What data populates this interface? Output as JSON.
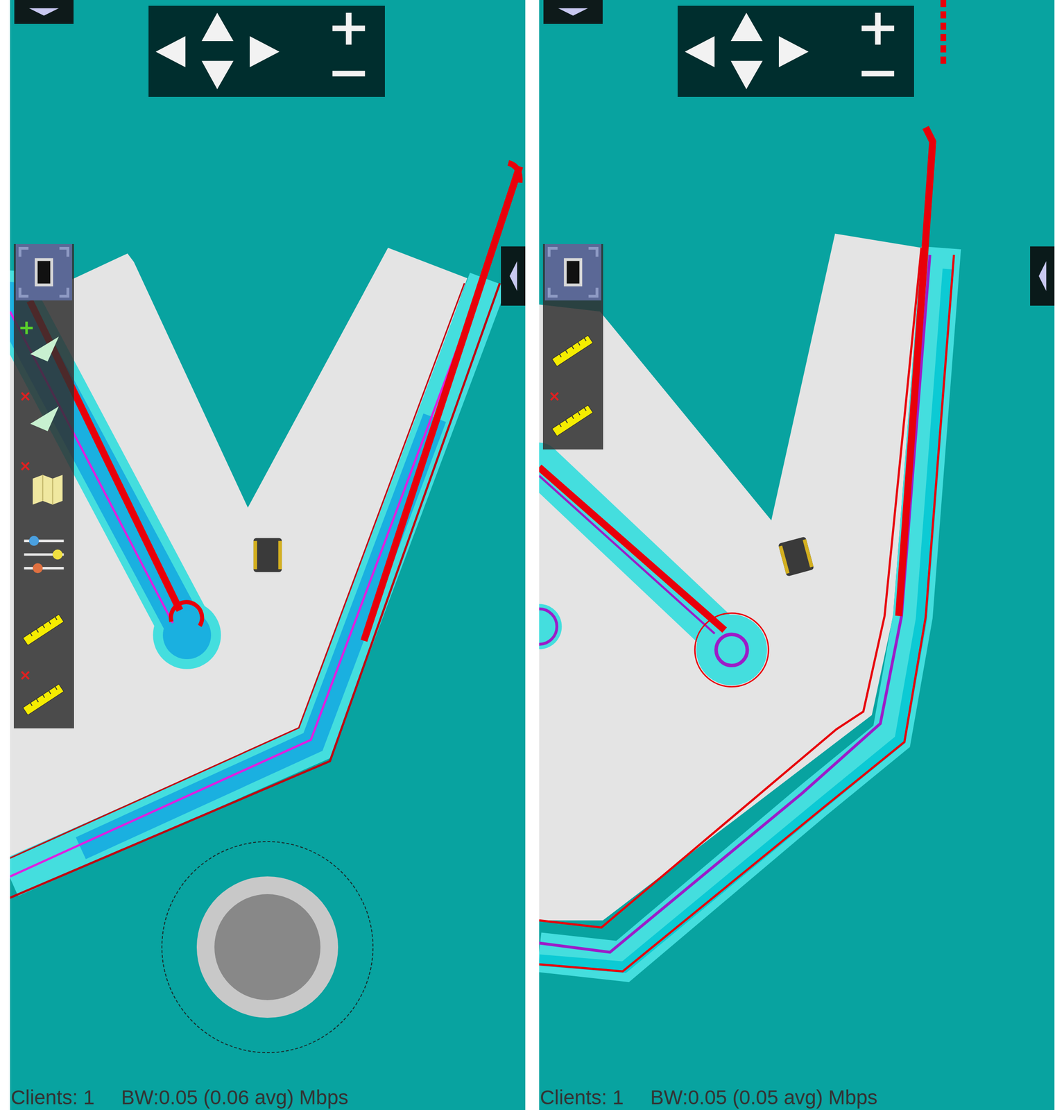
{
  "panels": [
    {
      "map": {
        "kind": "overview"
      },
      "toolbar": [
        {
          "kind": "fullscreen"
        },
        {
          "kind": "add-pose"
        },
        {
          "kind": "remove-pose"
        },
        {
          "kind": "remove-map"
        },
        {
          "kind": "settings"
        },
        {
          "kind": "ruler"
        },
        {
          "kind": "remove-ruler"
        }
      ],
      "joystick": {
        "visible": true
      },
      "status": {
        "clients": "Clients: 1",
        "bandwidth": "BW:0.05 (0.06 avg) Mbps"
      }
    },
    {
      "map": {
        "kind": "zoomed"
      },
      "toolbar": [
        {
          "kind": "fullscreen"
        },
        {
          "kind": "ruler"
        },
        {
          "kind": "remove-ruler"
        }
      ],
      "joystick": {
        "visible": false
      },
      "status": {
        "clients": "Clients: 1",
        "bandwidth": "BW:0.05 (0.05 avg) Mbps"
      }
    }
  ]
}
